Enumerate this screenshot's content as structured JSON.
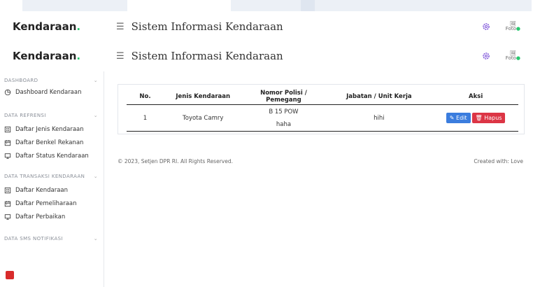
{
  "app": {
    "brand": "Kendaraan",
    "title": "Sistem Informasi Kendaraan"
  },
  "header": {
    "photo_alt": "Foto"
  },
  "sidebar": {
    "sections": [
      {
        "title": "DASHBOARD",
        "items": [
          {
            "label": "Dashboard Kendaraan",
            "icon": "pie-chart-icon"
          }
        ]
      },
      {
        "title": "DATA REFRENSI",
        "items": [
          {
            "label": "Daftar Jenis Kendaraan",
            "icon": "list-icon"
          },
          {
            "label": "Daftar Benkel Rekanan",
            "icon": "calendar-icon"
          },
          {
            "label": "Daftar Status Kendaraan",
            "icon": "monitor-icon"
          }
        ]
      },
      {
        "title": "DATA TRANSAKSI KENDARAAN",
        "items": [
          {
            "label": "Daftar Kendaraan",
            "icon": "list-icon"
          },
          {
            "label": "Daftar Pemeliharaan",
            "icon": "calendar-icon"
          },
          {
            "label": "Daftar Perbaikan",
            "icon": "monitor-icon"
          }
        ]
      },
      {
        "title": "DATA SMS NOTIFIKASI",
        "items": []
      }
    ]
  },
  "table": {
    "headers": [
      "No.",
      "Jenis Kendaraan",
      "Nomor Polisi / Pemegang",
      "Jabatan / Unit Kerja",
      "Aksi"
    ],
    "rows": [
      {
        "no": "1",
        "jenis": "Toyota Camry",
        "nopol": "B 15 POW",
        "pemegang": "haha",
        "jabatan": "hihi",
        "edit_label": "Edit",
        "delete_label": "Hapus"
      }
    ]
  },
  "footer": {
    "copyright": "© 2023, Setjen DPR RI. All Rights Reserved.",
    "credit": "Created with: Love"
  },
  "colors": {
    "accent_green": "#28c76f",
    "edit_blue": "#3b7dde",
    "delete_red": "#dc3545"
  }
}
